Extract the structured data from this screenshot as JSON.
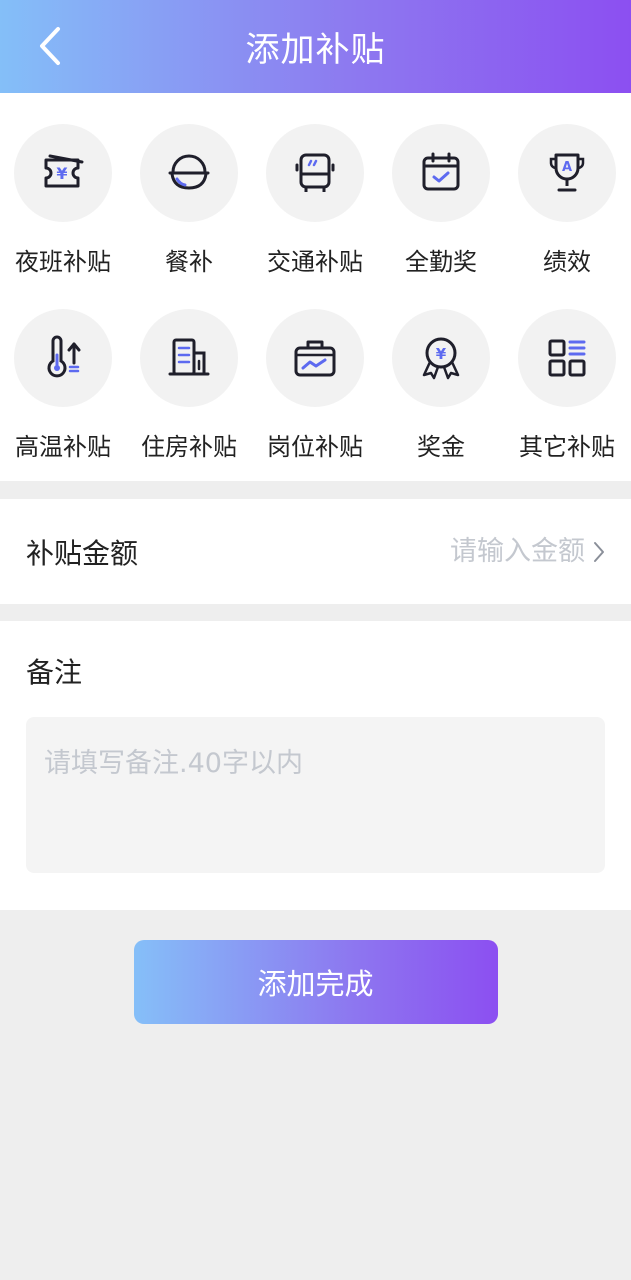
{
  "header": {
    "title": "添加补贴",
    "back_icon": "chevron-left-icon"
  },
  "categories": [
    {
      "label": "夜班补贴",
      "icon": "yen-ticket-icon"
    },
    {
      "label": "餐补",
      "icon": "rice-bowl-icon"
    },
    {
      "label": "交通补贴",
      "icon": "bus-icon"
    },
    {
      "label": "全勤奖",
      "icon": "calendar-check-icon"
    },
    {
      "label": "绩效",
      "icon": "trophy-icon"
    },
    {
      "label": "高温补贴",
      "icon": "thermometer-icon"
    },
    {
      "label": "住房补贴",
      "icon": "building-icon"
    },
    {
      "label": "岗位补贴",
      "icon": "briefcase-icon"
    },
    {
      "label": "奖金",
      "icon": "yen-medal-icon"
    },
    {
      "label": "其它补贴",
      "icon": "grid-list-icon"
    }
  ],
  "amount": {
    "label": "补贴金额",
    "placeholder": "请输入金额",
    "value": ""
  },
  "remark": {
    "label": "备注",
    "placeholder": "请填写备注.40字以内",
    "value": ""
  },
  "submit": {
    "label": "添加完成"
  },
  "colors": {
    "icon_stroke": "#1f1f2b",
    "icon_accent": "#5d6af0",
    "gradient_start": "#84bff8",
    "gradient_end": "#8c4ff1"
  }
}
